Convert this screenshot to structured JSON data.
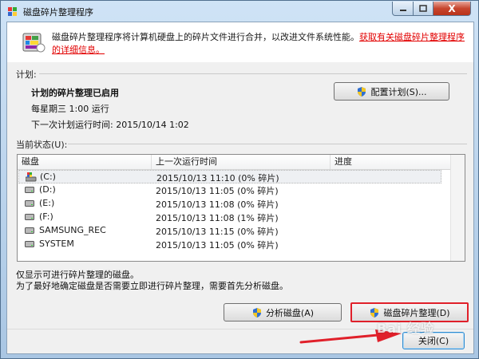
{
  "window": {
    "title": "磁盘碎片整理程序",
    "close_glyph": "X"
  },
  "header": {
    "description": "磁盘碎片整理程序将计算机硬盘上的碎片文件进行合并，以改进文件系统性能。",
    "link": "获取有关磁盘碎片整理程序的详细信息。"
  },
  "schedule": {
    "label": "计划:",
    "status": "计划的碎片整理已启用",
    "when": "每星期三  1:00 运行",
    "next_run": "下一次计划运行时间: 2015/10/14 1:02",
    "configure_button": "配置计划(S)..."
  },
  "current_status": {
    "label": "当前状态(U):",
    "columns": [
      "磁盘",
      "上一次运行时间",
      "进度"
    ],
    "rows": [
      {
        "disk": "(C:)",
        "last_run": "2015/10/13 11:10 (0% 碎片)",
        "progress": "",
        "icon": "system-drive-icon"
      },
      {
        "disk": "(D:)",
        "last_run": "2015/10/13 11:05 (0% 碎片)",
        "progress": "",
        "icon": "drive-icon"
      },
      {
        "disk": "(E:)",
        "last_run": "2015/10/13 11:08 (0% 碎片)",
        "progress": "",
        "icon": "drive-icon"
      },
      {
        "disk": "(F:)",
        "last_run": "2015/10/13 11:08 (1% 碎片)",
        "progress": "",
        "icon": "drive-icon"
      },
      {
        "disk": "SAMSUNG_REC",
        "last_run": "2015/10/13 11:15 (0% 碎片)",
        "progress": "",
        "icon": "drive-icon"
      },
      {
        "disk": "SYSTEM",
        "last_run": "2015/10/13 11:05 (0% 碎片)",
        "progress": "",
        "icon": "drive-icon"
      }
    ]
  },
  "notes": {
    "line1": "仅显示可进行碎片整理的磁盘。",
    "line2": "为了最好地确定磁盘是否需要立即进行碎片整理，需要首先分析磁盘。"
  },
  "buttons": {
    "analyze": "分析磁盘(A)",
    "defrag": "磁盘碎片整理(D)",
    "close": "关闭(C)"
  },
  "watermark": "Bai 经验",
  "colors": {
    "link": "#e20000",
    "highlight_border": "#e0202a",
    "title_close": "#c7462f"
  }
}
